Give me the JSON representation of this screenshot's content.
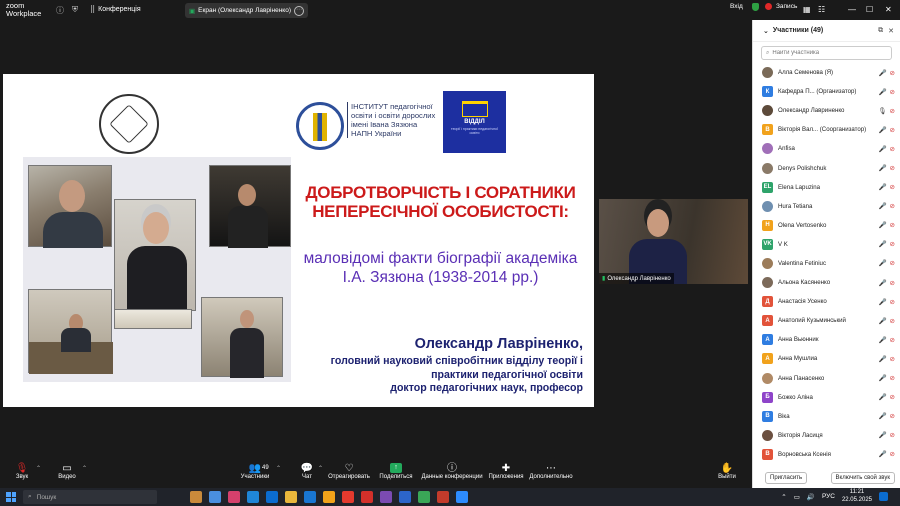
{
  "topbar": {
    "app_line1": "zoom",
    "app_line2": "Workplace",
    "conference": "Конференція",
    "screen_title": "Екран (Олександр Лавріненко)",
    "enter": "Вхід",
    "record": "Запись"
  },
  "slide": {
    "institute_text": "ІНСТИТУТ педагогічної освіти і освіти дорослих імені Івана Зязюна НАПН України",
    "viddil_title": "ВІДДІЛ",
    "viddil_sub": "теорії і практики педагогічної освіти",
    "headline": "ДОБРОТВОРЧІСТЬ І СОРАТНИКИ НЕПЕРЕСІЧНОЇ ОСОБИСТОСТІ:",
    "subtitle": "маловідомі факти біографії академіка І.А. Зязюна (1938-2014 рр.)",
    "author": "Олександр Лавріненко,",
    "position_line1": "головний науковий співробітник відділу теорії і",
    "position_line2": "практики педагогічної освіти",
    "position_line3": "доктор педагогічних наук, професор"
  },
  "video": {
    "name": "Олександр Лавріненко"
  },
  "participants": {
    "title": "Участники (49)",
    "search_placeholder": "Найти участника",
    "items": [
      {
        "initial": "",
        "name": "Алла Семенова (Я)",
        "color": "#7a6a58",
        "photo": true,
        "mic_ok": false
      },
      {
        "initial": "К",
        "name": "Кафедра П... (Организатор)",
        "color": "#2f7de1",
        "photo": false,
        "mic_ok": false
      },
      {
        "initial": "",
        "name": "Олександр Лавриненко",
        "color": "#5d4a3a",
        "photo": true,
        "mic_ok": true
      },
      {
        "initial": "В",
        "name": "Вікторія Вал... (Соорганизатор)",
        "color": "#f1a21c",
        "photo": false,
        "mic_ok": false
      },
      {
        "initial": "",
        "name": "Anfisa",
        "color": "#a06fb8",
        "photo": true,
        "mic_ok": false
      },
      {
        "initial": "",
        "name": "Denys Polishchuk",
        "color": "#8a7a68",
        "photo": true,
        "mic_ok": false
      },
      {
        "initial": "EL",
        "name": "Elena Lapuzina",
        "color": "#2ea36a",
        "photo": false,
        "mic_ok": false
      },
      {
        "initial": "",
        "name": "Hura Tetiana",
        "color": "#6f8fb0",
        "photo": true,
        "mic_ok": false
      },
      {
        "initial": "H",
        "name": "Olena Vertosenko",
        "color": "#f1a21c",
        "photo": false,
        "mic_ok": false
      },
      {
        "initial": "VK",
        "name": "V K",
        "color": "#2ea36a",
        "photo": false,
        "mic_ok": false
      },
      {
        "initial": "",
        "name": "Valentina Fetiniuc",
        "color": "#9c7c5a",
        "photo": true,
        "mic_ok": false
      },
      {
        "initial": "",
        "name": "Альона Касяненко",
        "color": "#7c6a5a",
        "photo": true,
        "mic_ok": false
      },
      {
        "initial": "Д",
        "name": "Анастасія Усенко",
        "color": "#e2533a",
        "photo": false,
        "mic_ok": false
      },
      {
        "initial": "А",
        "name": "Анатолий Кузьминський",
        "color": "#e2533a",
        "photo": false,
        "mic_ok": false
      },
      {
        "initial": "А",
        "name": "Анна Вьюнник",
        "color": "#2f7de1",
        "photo": false,
        "mic_ok": false
      },
      {
        "initial": "А",
        "name": "Анна Мушлиа",
        "color": "#f1a21c",
        "photo": false,
        "mic_ok": false
      },
      {
        "initial": "",
        "name": "Анна Панасенко",
        "color": "#b08a66",
        "photo": true,
        "mic_ok": false
      },
      {
        "initial": "Б",
        "name": "Божко Аліна",
        "color": "#8e44c9",
        "photo": false,
        "mic_ok": false
      },
      {
        "initial": "В",
        "name": "Віка",
        "color": "#2f7de1",
        "photo": false,
        "mic_ok": false
      },
      {
        "initial": "",
        "name": "Вікторія Ласиця",
        "color": "#6b5040",
        "photo": true,
        "mic_ok": false
      },
      {
        "initial": "В",
        "name": "Ворновська Ксенія",
        "color": "#e2533a",
        "photo": false,
        "mic_ok": false
      }
    ],
    "invite": "Пригласить",
    "unmute_all": "Включить свой звук"
  },
  "toolbar": {
    "audio": "Звук",
    "video": "Видео",
    "participants": "Участники",
    "participants_count": "49",
    "chat": "Чат",
    "react": "Отреагировать",
    "share": "Поделиться",
    "meeting_data": "Данные конференции",
    "apps": "Приложения",
    "more": "Дополнительно",
    "leave": "Выйти"
  },
  "taskbar": {
    "search_placeholder": "Пошук",
    "lang": "РУС",
    "time": "11:21",
    "date": "22.05.2025"
  }
}
